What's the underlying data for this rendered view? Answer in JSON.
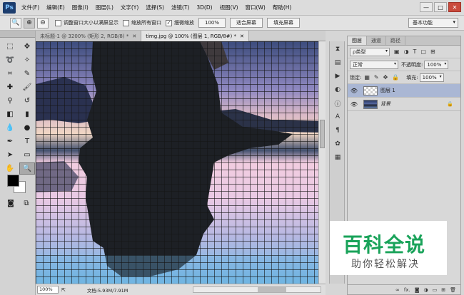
{
  "app": {
    "logo": "Ps"
  },
  "menu": [
    "文件(F)",
    "编辑(E)",
    "图像(I)",
    "图层(L)",
    "文字(Y)",
    "选择(S)",
    "滤镜(T)",
    "3D(D)",
    "视图(V)",
    "窗口(W)",
    "帮助(H)"
  ],
  "window_controls": {
    "minimize": "—",
    "maximize": "□",
    "close": "✕"
  },
  "options_bar": {
    "resize_windows_label": "调整窗口大小以满屏显示",
    "zoom_all_label": "缩放所有窗口",
    "scrubby_zoom_label": "细微缩放",
    "actual_pixels_button": "100%",
    "fit_screen_button": "适合屏幕",
    "fill_screen_button": "填充屏幕",
    "workspace": "基本功能"
  },
  "tabs": [
    {
      "label": "未标题-1 @ 3200% (矩形 2, RGB/8) *",
      "active": false
    },
    {
      "label": "timg.jpg @ 100% (图层 1, RGB/8#) *",
      "active": true
    }
  ],
  "status": {
    "zoom": "100%",
    "doc_info": "文档:5.93M/7.91M"
  },
  "layers_panel": {
    "tabs": [
      "图层",
      "通道",
      "路径"
    ],
    "filter_kind": "ρ类型",
    "blend_mode": "正常",
    "opacity_label": "不透明度:",
    "opacity_value": "100%",
    "lock_label": "锁定:",
    "fill_label": "填充:",
    "fill_value": "100%",
    "layers": [
      {
        "name": "图层 1",
        "selected": true
      },
      {
        "name": "背景",
        "selected": false
      }
    ]
  },
  "watermark": {
    "title": "百科全说",
    "subtitle": "助你轻松解决"
  },
  "colors": {
    "accent_green": "#1aa35a",
    "selection": "#aab7d4"
  }
}
